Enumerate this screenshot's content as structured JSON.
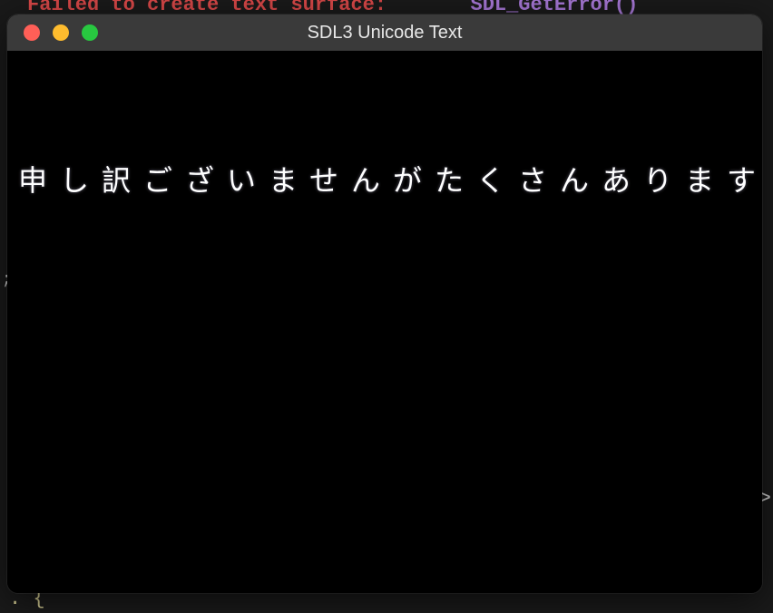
{
  "background": {
    "top_line_red": "Failed to create text surface:",
    "top_line_purple": "SDL_GetError()",
    "bottom_line": ". {",
    "right_char": ">",
    "left_char": ";"
  },
  "window": {
    "title": "SDL3 Unicode Text",
    "traffic_lights": {
      "close_color": "#ff5f57",
      "minimize_color": "#febc2e",
      "zoom_color": "#28c840"
    }
  },
  "content": {
    "text": "申し訳ございませんがたくさんあります。"
  }
}
